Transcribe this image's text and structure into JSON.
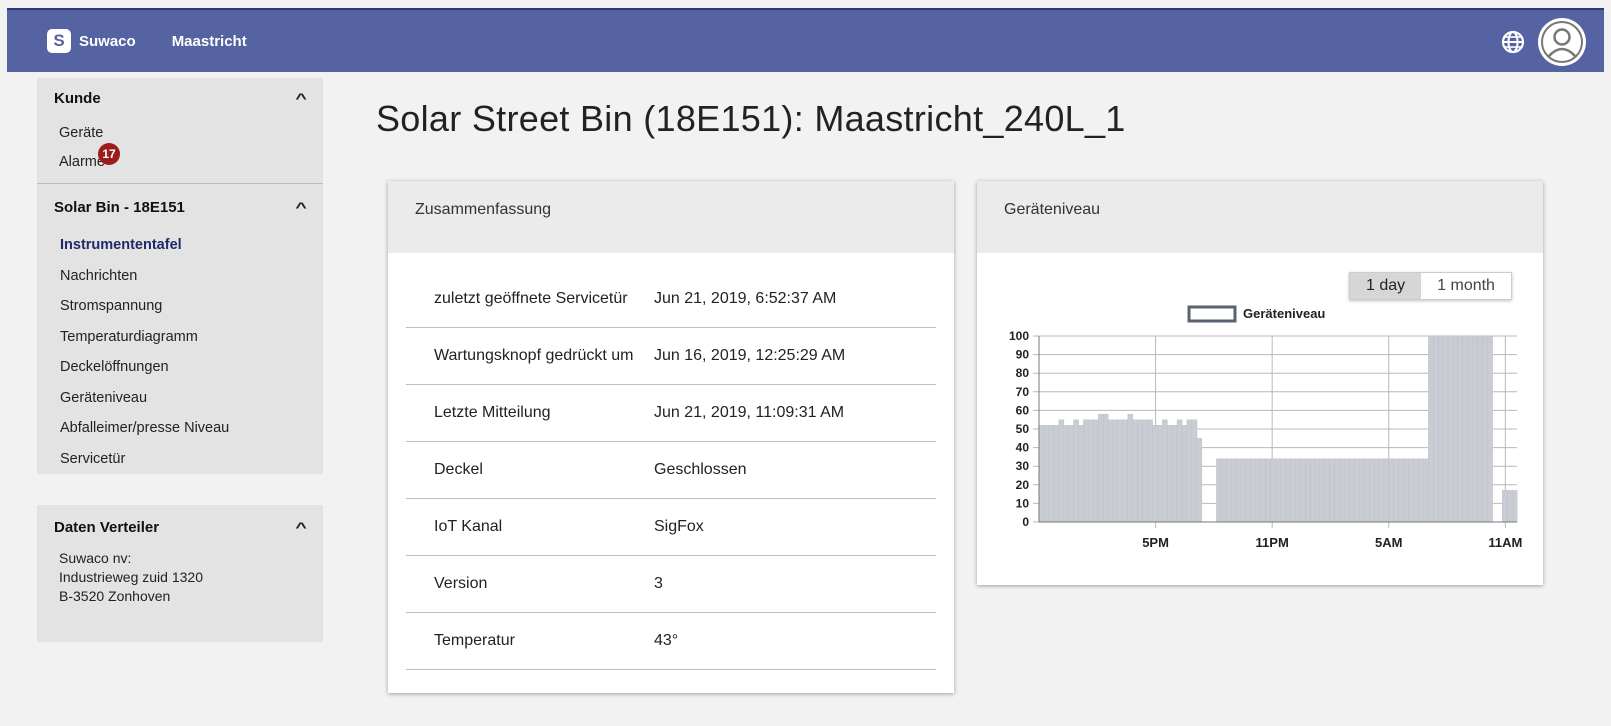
{
  "header": {
    "logo_letter": "S",
    "brand": "Suwaco",
    "city": "Maastricht",
    "icons": [
      "globe-icon",
      "user-avatar-icon"
    ]
  },
  "sidebar": {
    "kunde": {
      "title": "Kunde",
      "items": [
        "Geräte",
        "Alarme"
      ],
      "alarm_count": "17"
    },
    "device": {
      "title": "Solar Bin - 18E151",
      "items": [
        "Instrumententafel",
        "Nachrichten",
        "Stromspannung",
        "Temperaturdiagramm",
        "Deckelöffnungen",
        "Geräteniveau",
        "Abfalleimer/presse Niveau",
        "Servicetür"
      ],
      "active": "Instrumententafel"
    },
    "verteiler": {
      "title": "Daten Verteiler",
      "address": [
        "Suwaco nv:",
        "Industrieweg zuid 1320",
        "B-3520 Zonhoven"
      ]
    }
  },
  "page_title": "Solar Street Bin (18E151): Maastricht_240L_1",
  "summary": {
    "title": "Zusammenfassung",
    "rows": [
      {
        "label": "zuletzt geöffnete Servicetür",
        "value": "Jun 21, 2019, 6:52:37 AM"
      },
      {
        "label": "Wartungsknopf gedrückt um",
        "value": "Jun 16, 2019, 12:25:29 AM"
      },
      {
        "label": "Letzte Mitteilung",
        "value": "Jun 21, 2019, 11:09:31 AM"
      },
      {
        "label": "Deckel",
        "value": "Geschlossen"
      },
      {
        "label": "IoT Kanal",
        "value": "SigFox"
      },
      {
        "label": "Version",
        "value": "3"
      },
      {
        "label": "Temperatur",
        "value": "43°"
      }
    ]
  },
  "level_card": {
    "title": "Geräteniveau",
    "range_options": [
      "1 day",
      "1 month"
    ],
    "selected_range": "1 day"
  },
  "colors": {
    "topbar": "#5563a2",
    "badge": "#9b1c1c",
    "bars": "#c9ccd3",
    "legend_border": "#5a6270"
  },
  "chart_data": {
    "type": "bar",
    "title": "",
    "legend": [
      "Geräteniveau"
    ],
    "legend_position": "top",
    "grid": true,
    "ylim": [
      0,
      100
    ],
    "yticks": [
      "0",
      "10",
      "20",
      "30",
      "40",
      "50",
      "60",
      "70",
      "80",
      "90",
      "100"
    ],
    "xtick_labels": [
      "5PM",
      "11PM",
      "5AM",
      "11AM"
    ],
    "series": [
      {
        "name": "Geräteniveau",
        "values": [
          52,
          52,
          52,
          52,
          55,
          52,
          52,
          55,
          52,
          55,
          55,
          55,
          58,
          58,
          55,
          55,
          55,
          55,
          58,
          55,
          55,
          55,
          55,
          52,
          52,
          55,
          52,
          52,
          55,
          52,
          55,
          55,
          45,
          0,
          0,
          0,
          34,
          34,
          34,
          34,
          34,
          34,
          34,
          34,
          34,
          34,
          34,
          34,
          34,
          34,
          34,
          34,
          34,
          34,
          34,
          34,
          34,
          34,
          34,
          34,
          34,
          34,
          34,
          34,
          34,
          34,
          34,
          34,
          34,
          34,
          34,
          34,
          34,
          34,
          34,
          34,
          34,
          34,
          34,
          100,
          100,
          100,
          100,
          100,
          100,
          100,
          100,
          100,
          100,
          100,
          100,
          100,
          0,
          0,
          17,
          17,
          17
        ]
      }
    ]
  }
}
